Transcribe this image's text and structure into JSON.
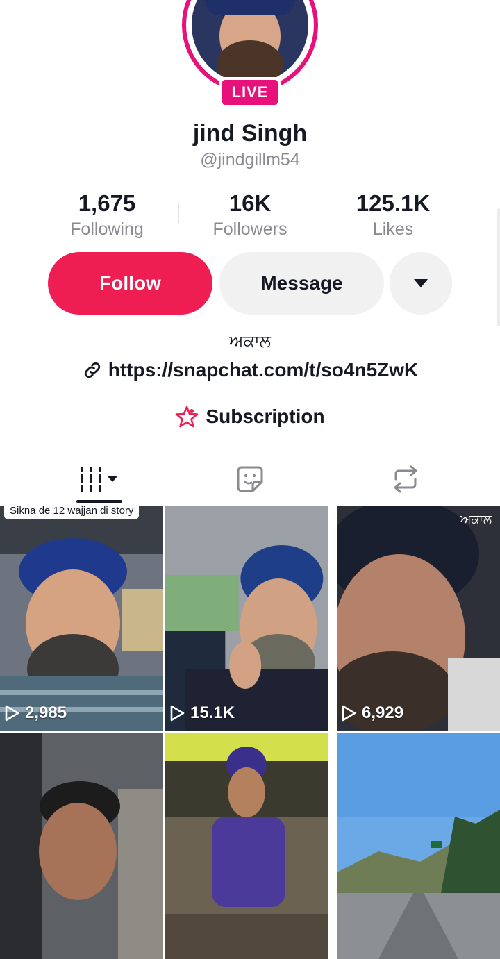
{
  "profile": {
    "live_badge": "LIVE",
    "name": "jind Singh",
    "handle": "@jindgillm54",
    "stats": [
      {
        "value": "1,675",
        "label": "Following"
      },
      {
        "value": "16K",
        "label": "Followers"
      },
      {
        "value": "125.1K",
        "label": "Likes"
      }
    ],
    "bio": "ਅਕਾਲ",
    "link": "https://snapchat.com/t/so4n5ZwK",
    "subscription": "Subscription"
  },
  "actions": {
    "follow": "Follow",
    "message": "Message"
  },
  "tabs": {
    "icons": [
      "videos-grid-icon",
      "sticker-icon",
      "repost-icon"
    ]
  },
  "videos": [
    {
      "views": "2,985",
      "caption": "Sikna de 12 wajjan di story"
    },
    {
      "views": "15.1K"
    },
    {
      "views": "6,929",
      "overlay": "ਅਕਾਲ"
    },
    {},
    {},
    {}
  ],
  "colors": {
    "accent": "#ee1d52",
    "live": "#e8107a",
    "secondary_text": "#8a8b91"
  }
}
